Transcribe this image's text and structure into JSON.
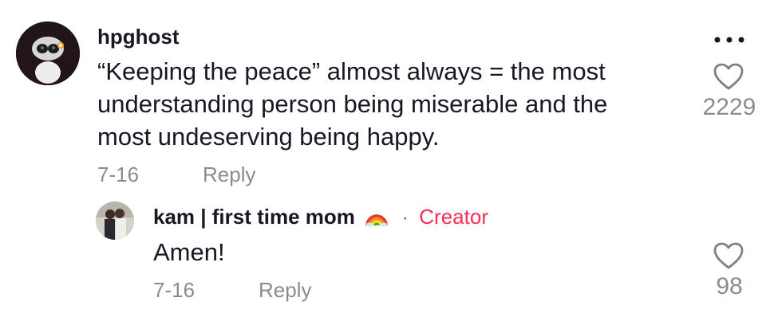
{
  "comment": {
    "username": "hpghost",
    "text": "“Keeping the peace” almost always = the most understanding person being miserable and the most undeserving being happy.",
    "date": "7-16",
    "reply_label": "Reply",
    "like_count": "2229",
    "avatar_icon": "robot-avatar",
    "more_icon": "more-options-icon",
    "like_icon": "heart-outline-icon"
  },
  "reply": {
    "username": "kam | first time mom",
    "username_emoji_icon": "rainbow-emoji-icon",
    "separator": "·",
    "creator_badge": "Creator",
    "text": "Amen!",
    "date": "7-16",
    "reply_label": "Reply",
    "like_count": "98",
    "avatar_icon": "couple-photo-avatar",
    "like_icon": "heart-outline-icon"
  },
  "colors": {
    "creator": "#fe2c55",
    "text": "#161823",
    "muted": "rgba(22,24,35,0.5)"
  }
}
